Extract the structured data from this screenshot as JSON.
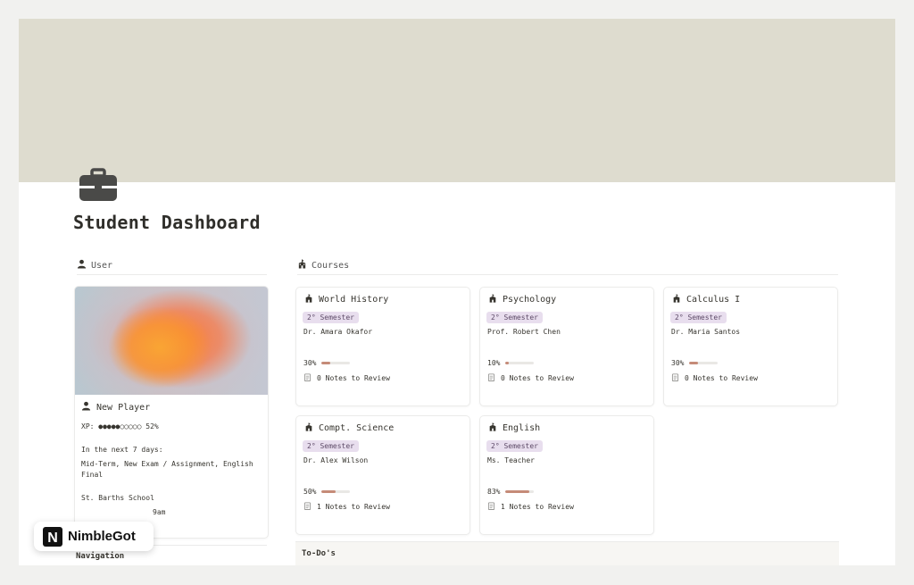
{
  "page": {
    "title": "Student Dashboard",
    "icon": "briefcase-icon",
    "cover_color": "#dedccf"
  },
  "user_section": {
    "heading": "User",
    "icon": "person-icon",
    "card": {
      "name": "New Player",
      "xp": "XP: ●●●●●○○○○○ 52%",
      "next_days_label": "In the next 7 days:",
      "upcoming": "Mid-Term, New Exam / Assignment, English Final",
      "school": "St. Barths School",
      "time_fragment": "9am"
    }
  },
  "navigation": {
    "heading": "Navigation"
  },
  "courses_section": {
    "heading": "Courses",
    "icon": "school-icon",
    "courses": [
      {
        "title": "World History",
        "semester": "2° Semester",
        "teacher": "Dr. Amara Okafor",
        "progress_label": "30%",
        "progress": 0.3,
        "notes": "0 Notes to Review"
      },
      {
        "title": "Psychology",
        "semester": "2° Semester",
        "teacher": "Prof. Robert Chen",
        "progress_label": "10%",
        "progress": 0.1,
        "notes": "0 Notes to Review"
      },
      {
        "title": "Calculus I",
        "semester": "2° Semester",
        "teacher": "Dr. Maria Santos",
        "progress_label": "30%",
        "progress": 0.3,
        "notes": "0 Notes to Review"
      },
      {
        "title": "Compt. Science",
        "semester": "2° Semester",
        "teacher": "Dr. Alex Wilson",
        "progress_label": "50%",
        "progress": 0.5,
        "notes": "1 Notes to Review"
      },
      {
        "title": "English",
        "semester": "2° Semester",
        "teacher": "Ms. Teacher",
        "progress_label": "83%",
        "progress": 0.83,
        "notes": "1 Notes to Review"
      }
    ]
  },
  "todos": {
    "heading": "To-Do's"
  },
  "watermark": {
    "brand": "NimbleGot",
    "logo_letter": "N"
  },
  "colors": {
    "semester_bg": "#e8deee",
    "semester_text": "#5e4b68",
    "progress_fill": "#c58b78"
  }
}
